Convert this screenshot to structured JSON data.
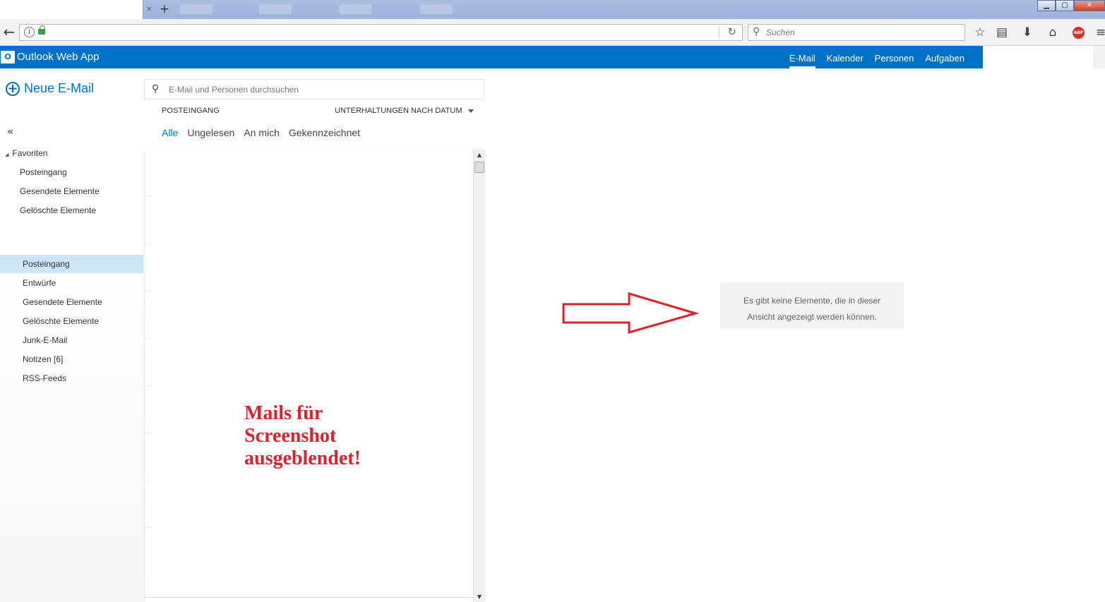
{
  "browser": {
    "new_tab_symbol": "+",
    "tab_close_symbol": "×",
    "search_placeholder": "Suchen",
    "window_controls": {
      "minimize": "▁",
      "maximize": "▢",
      "close": "✕"
    },
    "abp_label": "ABP"
  },
  "owa": {
    "logo_text": "O",
    "title": "Outlook Web App",
    "nav": [
      "E-Mail",
      "Kalender",
      "Personen",
      "Aufgaben"
    ]
  },
  "sidebar": {
    "new_mail_label": "Neue E-Mail",
    "collapse_symbol": "«",
    "favorites_label": "Favoriten",
    "favorites": [
      "Posteingang",
      "Gesendete Elemente",
      "Gelöschte Elemente"
    ],
    "folders": [
      "Posteingang",
      "Entwürfe",
      "Gesendete Elemente",
      "Gelöschte Elemente",
      "Junk-E-Mail",
      "Notizen [6]",
      "RSS-Feeds"
    ],
    "selected_folder": "Posteingang"
  },
  "mail_list": {
    "search_placeholder": "E-Mail und Personen durchsuchen",
    "folder_header": "POSTEINGANG",
    "sort_label": "UNTERHALTUNGEN NACH DATUM",
    "filters": [
      "Alle",
      "Ungelesen",
      "An mich",
      "Gekennzeichnet"
    ],
    "active_filter": "Alle",
    "annotation": "Mails für Screenshot ausgeblendet!"
  },
  "reading_pane": {
    "empty_line1": "Es gibt keine Elemente, die in dieser",
    "empty_line2": "Ansicht angezeigt werden können."
  },
  "colors": {
    "owa_blue": "#0072c6",
    "selected_folder_bg": "#cde6f7",
    "annotation_red": "#e0202a"
  }
}
